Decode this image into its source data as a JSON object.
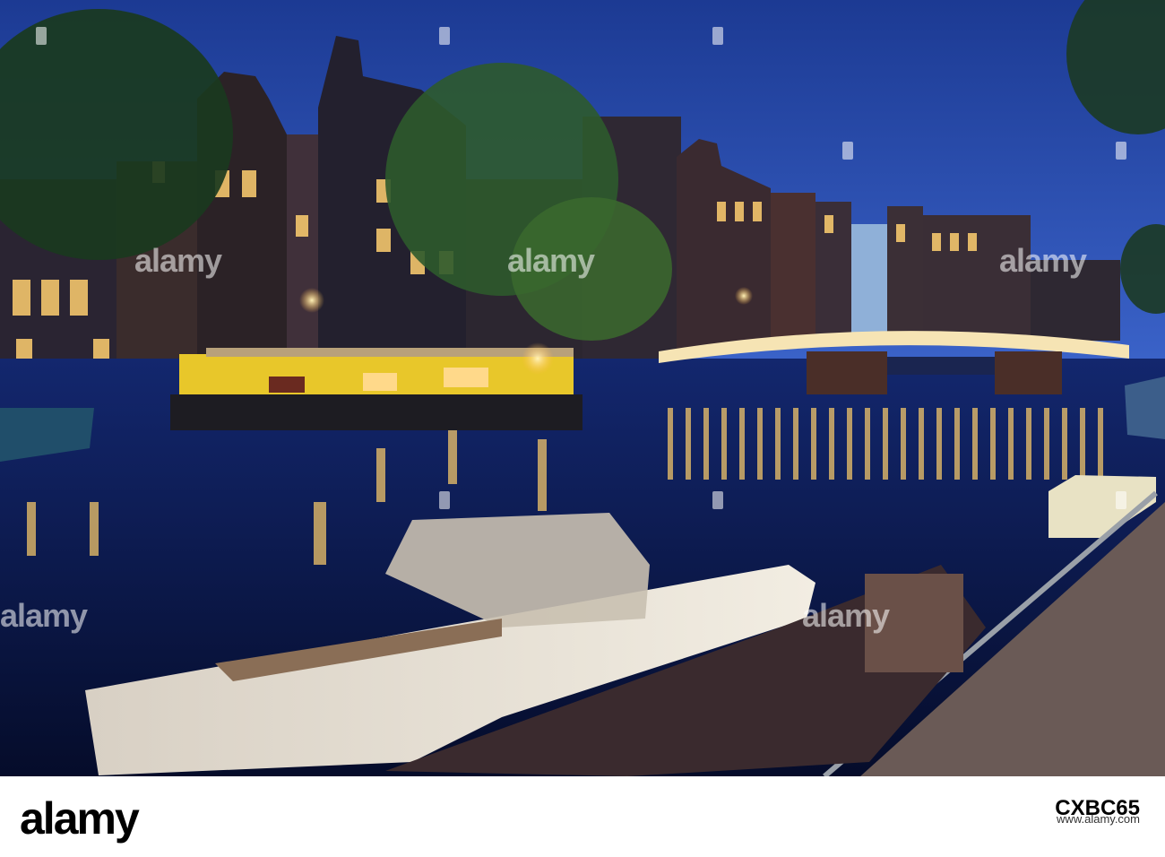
{
  "photo": {
    "description_colors": {
      "sky": "#1f3f9c",
      "water": "#0b1a4a",
      "lights": "#ffd77a"
    }
  },
  "watermark": {
    "text": "alamy"
  },
  "footer": {
    "logo": "alamy",
    "image_id": "CXBC65",
    "url": "www.alamy.com"
  }
}
